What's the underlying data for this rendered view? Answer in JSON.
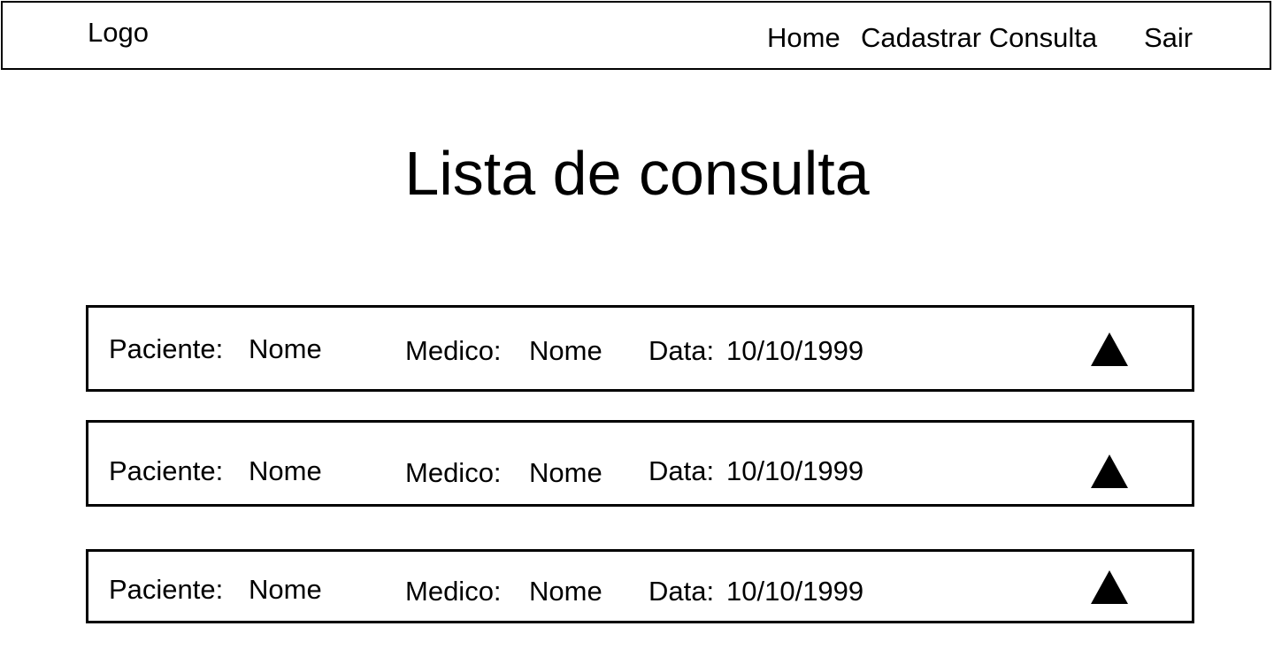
{
  "header": {
    "logo": "Logo",
    "nav": {
      "home": "Home",
      "cadastrar": "Cadastrar Consulta",
      "sair": "Sair"
    }
  },
  "page": {
    "title": "Lista de consulta"
  },
  "consultas": [
    {
      "paciente_label": "Paciente:",
      "paciente": "Nome",
      "medico_label": "Medico:",
      "medico": "Nome",
      "data_label": "Data:",
      "data": "10/10/1999",
      "icon": "triangle-up-icon"
    },
    {
      "paciente_label": "Paciente:",
      "paciente": "Nome",
      "medico_label": "Medico:",
      "medico": "Nome",
      "data_label": "Data:",
      "data": "10/10/1999",
      "icon": "triangle-up-icon"
    },
    {
      "paciente_label": "Paciente:",
      "paciente": "Nome",
      "medico_label": "Medico:",
      "medico": "Nome",
      "data_label": "Data:",
      "data": "10/10/1999",
      "icon": "triangle-up-icon"
    }
  ]
}
